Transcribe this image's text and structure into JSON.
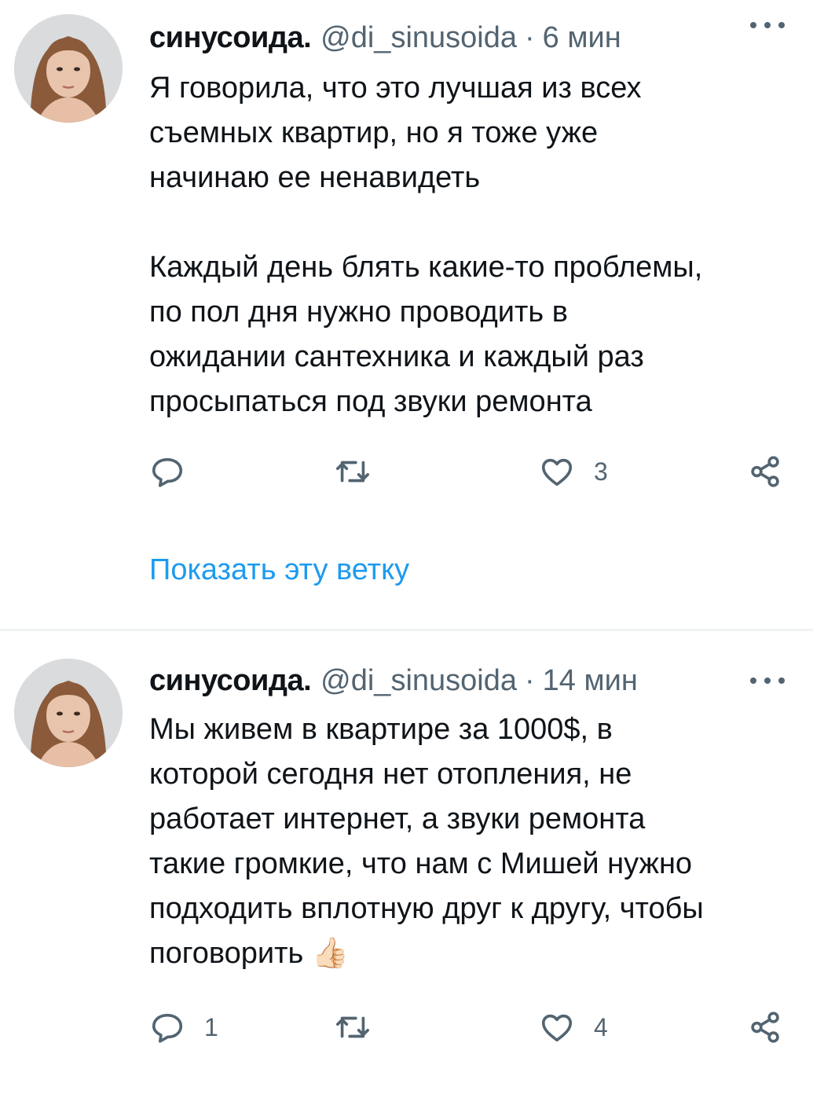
{
  "tweets": [
    {
      "author": {
        "name": "синусоида.",
        "handle": "@di_sinusoida"
      },
      "separator": "·",
      "time": "6 мин",
      "text": "Я говорила, что это лучшая из всех\nсъемных квартир, но я тоже уже\nначинаю ее ненавидеть\n\nКаждый день блять какие-то проблемы,\nпо пол дня нужно проводить в\nожидании сантехника и каждый раз\nпросыпаться под звуки ремонта",
      "reply_count": "",
      "retweet_count": "",
      "like_count": "3",
      "show_thread_label": "Показать эту ветку"
    },
    {
      "author": {
        "name": "синусоида.",
        "handle": "@di_sinusoida"
      },
      "separator": "·",
      "time": "14 мин",
      "text": "Мы живем в квартире за 1000$, в\nкоторой сегодня нет отопления, не\nработает интернет, а звуки ремонта\nтакие громкие, что нам с Мишей нужно\nподходить вплотную друг к другу, чтобы\nпоговорить 👍🏻",
      "reply_count": "1",
      "retweet_count": "",
      "like_count": "4"
    }
  ],
  "icons": {
    "more": "more-horizontal-icon",
    "reply": "reply-icon",
    "retweet": "retweet-icon",
    "like": "heart-icon",
    "share": "share-icon"
  },
  "colors": {
    "link": "#1d9bf0",
    "secondary_text": "#536471",
    "divider": "#eff3f4"
  }
}
